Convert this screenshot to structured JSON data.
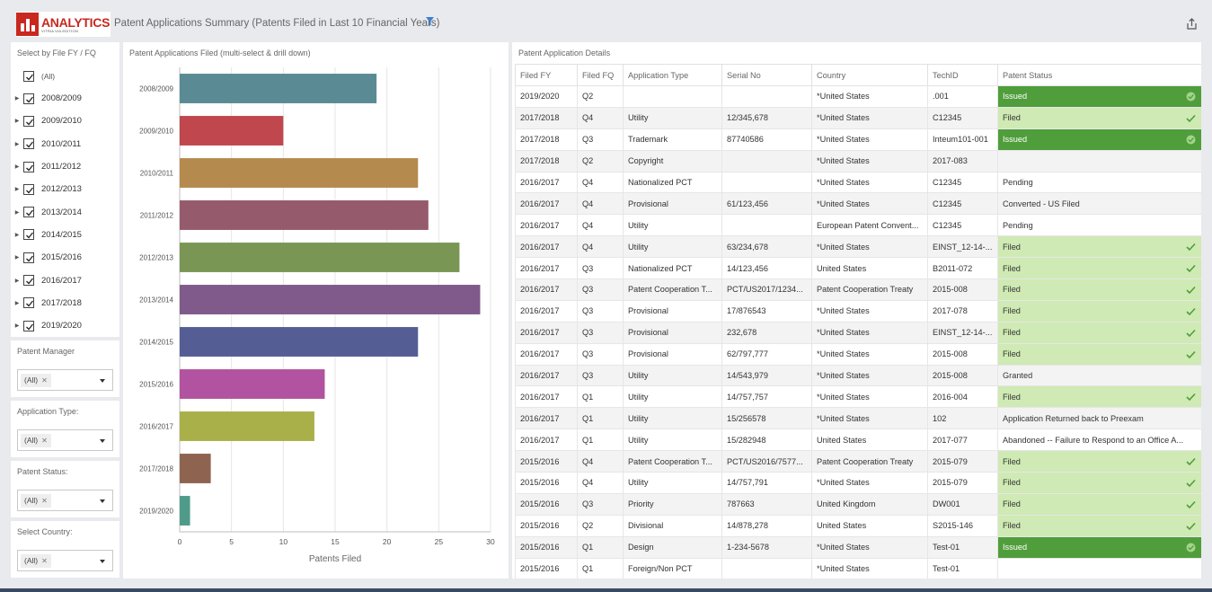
{
  "header": {
    "logo_text": "ANALYTICS",
    "logo_sub": "VITRIA VIA EDITION",
    "title": "Patent Applications Summary (Patents Filed in Last 10 Financial Years)",
    "colors": {
      "logo": "#c8281e",
      "issued": "#4f9e3b",
      "filed": "#cfeab4",
      "filter_icon": "#3b7fd0"
    }
  },
  "fy_filter": {
    "title": "Select by File FY / FQ",
    "all_label": "(All)",
    "items": [
      "2008/2009",
      "2009/2010",
      "2010/2011",
      "2011/2012",
      "2012/2013",
      "2013/2014",
      "2014/2015",
      "2015/2016",
      "2016/2017",
      "2017/2018",
      "2019/2020"
    ]
  },
  "filters": [
    {
      "title": "Patent Manager",
      "value": "(All)"
    },
    {
      "title": "Application Type:",
      "value": "(All)"
    },
    {
      "title": "Patent Status:",
      "value": "(All)"
    },
    {
      "title": "Select Country:",
      "value": "(All)"
    }
  ],
  "chart_panel": {
    "title": "Patent Applications Filed (multi-select & drill down)"
  },
  "chart_data": {
    "type": "bar",
    "orientation": "horizontal",
    "categories": [
      "2008/2009",
      "2009/2010",
      "2010/2011",
      "2011/2012",
      "2012/2013",
      "2013/2014",
      "2014/2015",
      "2015/2016",
      "2016/2017",
      "2017/2018",
      "2019/2020"
    ],
    "values": [
      19,
      10,
      23,
      24,
      27,
      29,
      23,
      14,
      13,
      3,
      1
    ],
    "colors": [
      "#5a8b94",
      "#c0474d",
      "#b58a4e",
      "#955a6c",
      "#7a9654",
      "#7f5a8b",
      "#545e95",
      "#b153a0",
      "#a9b049",
      "#8e6450",
      "#4f9b8a"
    ],
    "xlabel": "Patents Filed",
    "xlim": [
      0,
      30
    ],
    "xticks": [
      0,
      5,
      10,
      15,
      20,
      25,
      30
    ],
    "grid": true
  },
  "table": {
    "title": "Patent Application Details",
    "columns": [
      "Filed FY",
      "Filed FQ",
      "Application Type",
      "Serial No",
      "Country",
      "TechID",
      "Patent Status"
    ],
    "rows": [
      [
        "2019/2020",
        "Q2",
        "",
        "",
        "*United States",
        ".001",
        "Issued"
      ],
      [
        "2017/2018",
        "Q4",
        "Utility",
        "12/345,678",
        "*United States",
        "C12345",
        "Filed"
      ],
      [
        "2017/2018",
        "Q3",
        "Trademark",
        "87740586",
        "*United States",
        "Inteum101-001",
        "Issued"
      ],
      [
        "2017/2018",
        "Q2",
        "Copyright",
        "",
        "*United States",
        "2017-083",
        ""
      ],
      [
        "2016/2017",
        "Q4",
        "Nationalized PCT",
        "",
        "*United States",
        "C12345",
        "Pending"
      ],
      [
        "2016/2017",
        "Q4",
        "Provisional",
        "61/123,456",
        "*United States",
        "C12345",
        "Converted - US Filed"
      ],
      [
        "2016/2017",
        "Q4",
        "Utility",
        "",
        "European Patent Convent...",
        "C12345",
        "Pending"
      ],
      [
        "2016/2017",
        "Q4",
        "Utility",
        "63/234,678",
        "*United States",
        "EINST_12-14-...",
        "Filed"
      ],
      [
        "2016/2017",
        "Q3",
        "Nationalized PCT",
        "14/123,456",
        "United States",
        "B2011-072",
        "Filed"
      ],
      [
        "2016/2017",
        "Q3",
        "Patent Cooperation T...",
        "PCT/US2017/1234...",
        "Patent Cooperation Treaty",
        "2015-008",
        "Filed"
      ],
      [
        "2016/2017",
        "Q3",
        "Provisional",
        "17/876543",
        "*United States",
        "2017-078",
        "Filed"
      ],
      [
        "2016/2017",
        "Q3",
        "Provisional",
        "232,678",
        "*United States",
        "EINST_12-14-...",
        "Filed"
      ],
      [
        "2016/2017",
        "Q3",
        "Provisional",
        "62/797,777",
        "*United States",
        "2015-008",
        "Filed"
      ],
      [
        "2016/2017",
        "Q3",
        "Utility",
        "14/543,979",
        "*United States",
        "2015-008",
        "Granted"
      ],
      [
        "2016/2017",
        "Q1",
        "Utility",
        "14/757,757",
        "*United States",
        "2016-004",
        "Filed"
      ],
      [
        "2016/2017",
        "Q1",
        "Utility",
        "15/256578",
        "*United States",
        "102",
        "Application Returned back to Preexam"
      ],
      [
        "2016/2017",
        "Q1",
        "Utility",
        "15/282948",
        "United States",
        "2017-077",
        "Abandoned -- Failure to Respond to an Office A..."
      ],
      [
        "2015/2016",
        "Q4",
        "Patent Cooperation T...",
        "PCT/US2016/7577...",
        "Patent Cooperation Treaty",
        "2015-079",
        "Filed"
      ],
      [
        "2015/2016",
        "Q4",
        "Utility",
        "14/757,791",
        "*United States",
        "2015-079",
        "Filed"
      ],
      [
        "2015/2016",
        "Q3",
        "Priority",
        "787663",
        "United Kingdom",
        "DW001",
        "Filed"
      ],
      [
        "2015/2016",
        "Q2",
        "Divisional",
        "14/878,278",
        "United States",
        "S2015-146",
        "Filed"
      ],
      [
        "2015/2016",
        "Q1",
        "Design",
        "1-234-5678",
        "*United States",
        "Test-01",
        "Issued"
      ],
      [
        "2015/2016",
        "Q1",
        "Foreign/Non PCT",
        "",
        "*United States",
        "Test-01",
        ""
      ]
    ]
  }
}
